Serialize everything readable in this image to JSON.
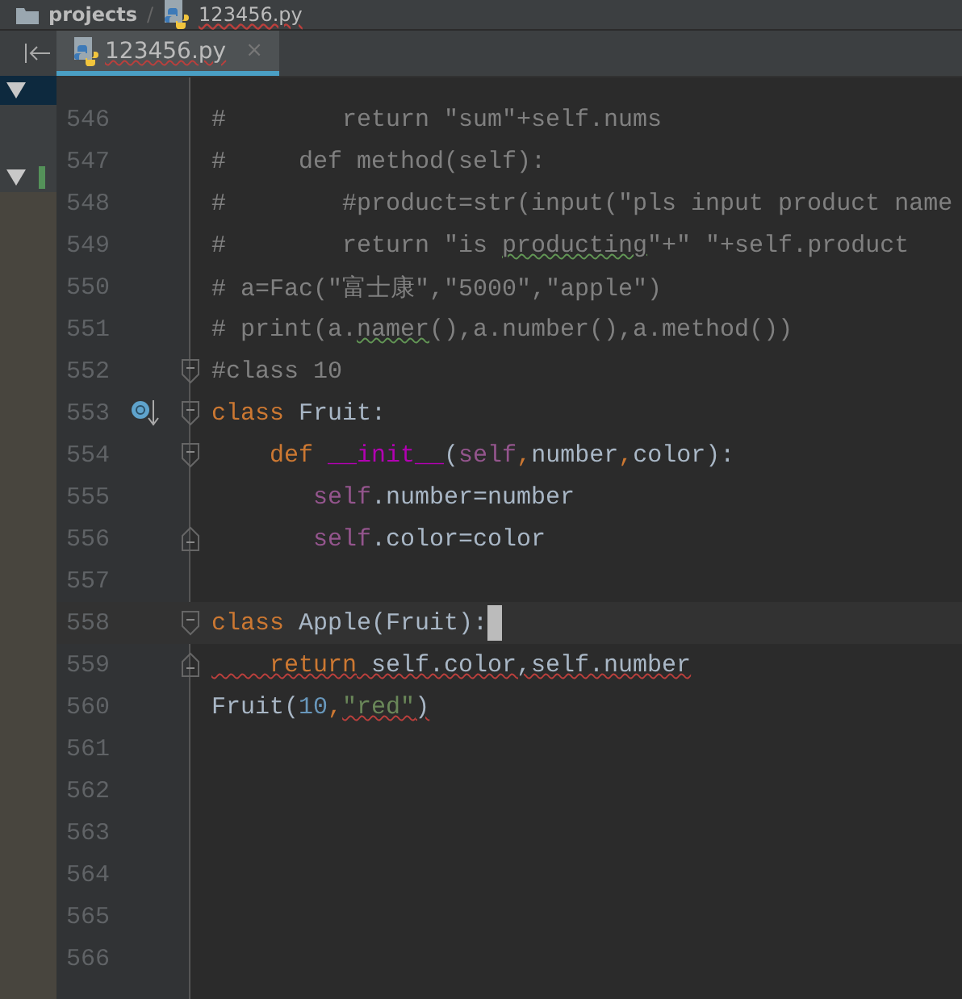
{
  "breadcrumb": [
    {
      "label": "projects",
      "kind": "folder"
    },
    {
      "label": "123456.py",
      "kind": "file",
      "error": true
    }
  ],
  "breadcrumb_separator": "/",
  "tabs": [
    {
      "label": "123456.py",
      "selected": true,
      "error": true,
      "close": "×"
    }
  ],
  "lines": [
    {
      "number": "546",
      "tokens": [
        {
          "text": "#        return \"sum\"+self.nums",
          "kind": "comment"
        }
      ]
    },
    {
      "number": "547",
      "tokens": [
        {
          "text": "#     def method(self):",
          "kind": "comment"
        }
      ]
    },
    {
      "number": "548",
      "tokens": [
        {
          "text": "#        #product=str(input(\"pls input product name",
          "kind": "comment"
        }
      ]
    },
    {
      "number": "549",
      "tokens": [
        {
          "text": "#        return \"is ",
          "kind": "comment"
        },
        {
          "text": "producting",
          "kind": "comment",
          "warning": true
        },
        {
          "text": "\"+\" \"+self.product",
          "kind": "comment"
        }
      ]
    },
    {
      "number": "550",
      "tokens": [
        {
          "text": "# a=Fac(\"富士康\",\"5000\",\"apple\")",
          "kind": "comment"
        }
      ]
    },
    {
      "number": "551",
      "tokens": [
        {
          "text": "# print(a.",
          "kind": "comment"
        },
        {
          "text": "namer",
          "kind": "comment",
          "warning": true
        },
        {
          "text": "(),a.number(),a.method())",
          "kind": "comment"
        }
      ]
    },
    {
      "number": "552",
      "fold_start": true,
      "tokens": [
        {
          "text": "#class 10",
          "kind": "comment"
        }
      ]
    },
    {
      "number": "553",
      "fold_start": true,
      "override": true,
      "tokens": [
        {
          "text": "class",
          "kind": "keyword"
        },
        {
          "text": " Fruit:",
          "kind": "plain"
        }
      ]
    },
    {
      "number": "554",
      "fold_start": true,
      "tokens": [
        {
          "text": "    def",
          "kind": "keyword"
        },
        {
          "text": " __init__",
          "kind": "magic"
        },
        {
          "text": "(",
          "kind": "plain"
        },
        {
          "text": "self",
          "kind": "self"
        },
        {
          "text": ",",
          "kind": "keyword"
        },
        {
          "text": "number",
          "kind": "plain"
        },
        {
          "text": ",",
          "kind": "keyword"
        },
        {
          "text": "color):",
          "kind": "plain"
        }
      ]
    },
    {
      "number": "555",
      "tokens": [
        {
          "text": "       self",
          "kind": "self"
        },
        {
          "text": ".number=number",
          "kind": "plain"
        }
      ]
    },
    {
      "number": "556",
      "fold_end": true,
      "tokens": [
        {
          "text": "       self",
          "kind": "self"
        },
        {
          "text": ".color=color",
          "kind": "plain"
        }
      ]
    },
    {
      "number": "557"
    },
    {
      "number": "558",
      "fold_start": true,
      "current": true,
      "tokens": [
        {
          "text": "class",
          "kind": "keyword"
        },
        {
          "text": " Apple(Fruit):",
          "kind": "plain"
        }
      ]
    },
    {
      "number": "559",
      "fold_end": true,
      "tokens": [
        {
          "text": "    return",
          "kind": "keyword",
          "error": true
        },
        {
          "text": " self.color,self.number",
          "kind": "plain",
          "error": true
        }
      ]
    },
    {
      "number": "560",
      "tokens": [
        {
          "text": "Fruit(",
          "kind": "plain"
        },
        {
          "text": "10",
          "kind": "number"
        },
        {
          "text": ",",
          "kind": "keyword"
        },
        {
          "text": "\"red\"",
          "kind": "string",
          "error": true
        },
        {
          "text": ")",
          "kind": "plain",
          "error": true
        }
      ]
    },
    {
      "number": "561"
    },
    {
      "number": "562"
    },
    {
      "number": "563"
    },
    {
      "number": "564"
    },
    {
      "number": "565"
    },
    {
      "number": "566"
    }
  ]
}
